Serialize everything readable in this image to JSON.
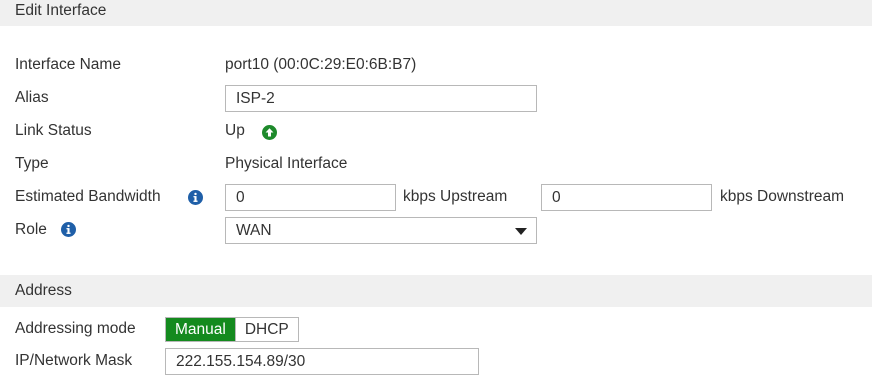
{
  "header": {
    "title": "Edit Interface"
  },
  "fields": {
    "interface_name": {
      "label": "Interface Name",
      "value": "port10 (00:0C:29:E0:6B:B7)"
    },
    "alias": {
      "label": "Alias",
      "value": "ISP-2"
    },
    "link_status": {
      "label": "Link Status",
      "value": "Up",
      "icon": "arrow-up-circle-icon",
      "color": "#1e8a2b"
    },
    "type": {
      "label": "Type",
      "value": "Physical Interface"
    },
    "bandwidth": {
      "label": "Estimated Bandwidth",
      "upstream_value": "0",
      "upstream_unit": "kbps Upstream",
      "downstream_value": "0",
      "downstream_unit": "kbps Downstream"
    },
    "role": {
      "label": "Role",
      "selected": "WAN"
    }
  },
  "address": {
    "title": "Address",
    "addressing_mode": {
      "label": "Addressing mode",
      "options": [
        "Manual",
        "DHCP"
      ],
      "selected": "Manual"
    },
    "ip_mask": {
      "label": "IP/Network Mask",
      "value": "222.155.154.89/30"
    }
  },
  "colors": {
    "accent": "#148a1e",
    "info_icon": "#1f5fa8",
    "header_bg": "#f0f0f0"
  }
}
